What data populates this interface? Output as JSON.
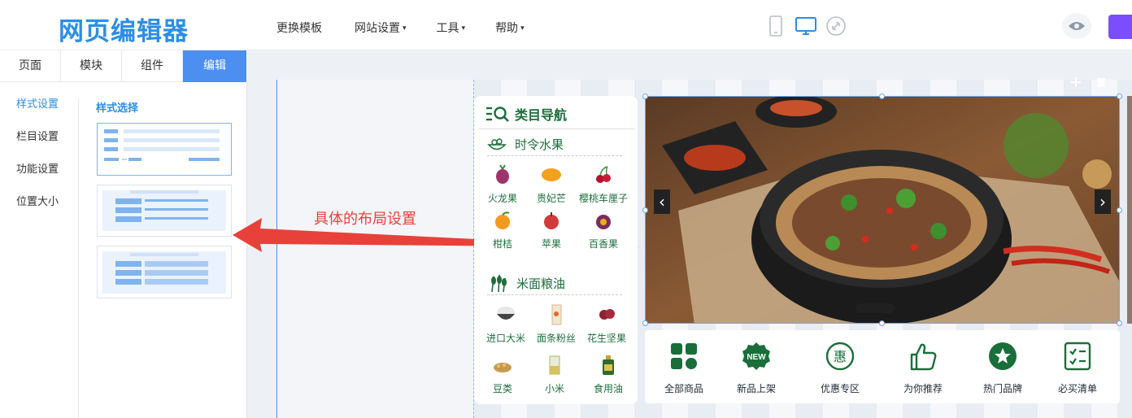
{
  "logo": "网页编辑器",
  "nav": [
    {
      "label": "更换模板",
      "caret": ""
    },
    {
      "label": "网站设置",
      "caret": "▾"
    },
    {
      "label": "工具",
      "caret": "▾"
    },
    {
      "label": "帮助",
      "caret": "▾"
    }
  ],
  "left_tabs": [
    "页面",
    "模块",
    "组件",
    "编辑"
  ],
  "active_tab": "编辑",
  "settings_menu": [
    "样式设置",
    "栏目设置",
    "功能设置",
    "位置大小"
  ],
  "style_select_title": "样式选择",
  "annotation": "具体的布局设置",
  "category_nav": {
    "title": "类目导航",
    "sections": [
      {
        "name": "时令水果",
        "items": [
          "火龙果",
          "贵妃芒",
          "樱桃车厘子",
          "柑桔",
          "苹果",
          "百香果"
        ]
      },
      {
        "name": "米面粮油",
        "items": [
          "进口大米",
          "面条粉丝",
          "花生坚果",
          "豆类",
          "小米",
          "食用油"
        ]
      }
    ]
  },
  "quick_links": [
    "全部商品",
    "新品上架",
    "优惠专区",
    "为你推荐",
    "热门品牌",
    "必买清单"
  ],
  "badges": {
    "new_badge": "NEW",
    "discount_char": "惠"
  },
  "banner_arrows": {
    "prev": "‹",
    "next": "›"
  },
  "colors": {
    "brand_blue": "#2b8ee6",
    "active_tab_blue": "#4c8ff0",
    "green": "#1a6e3a",
    "annotation_red": "#e8413a",
    "purple": "#7b4dff"
  }
}
